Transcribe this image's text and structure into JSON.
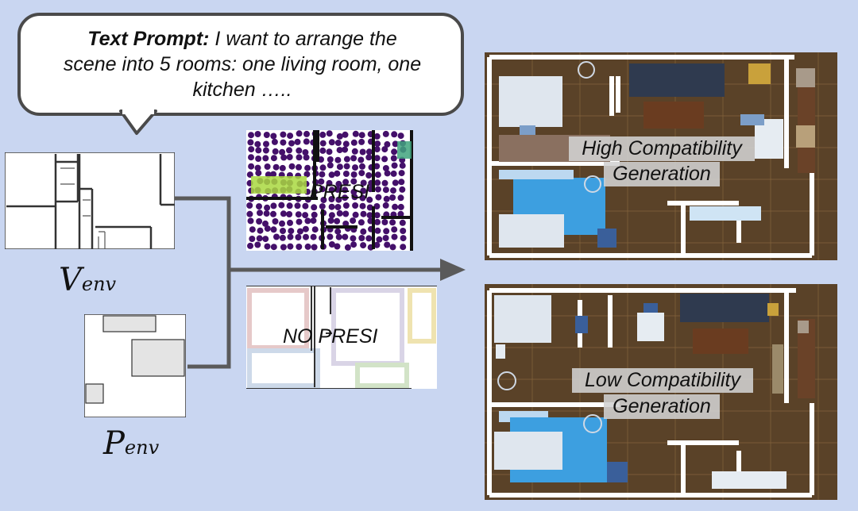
{
  "prompt": {
    "lead": "Text Prompt:",
    "line1_rest": " I want to arrange the",
    "line2": "scene into 5 rooms: one living room, one",
    "line3": "kitchen ….."
  },
  "inputs": {
    "v_env_main": "V",
    "v_env_sub": "env",
    "p_env_main": "P",
    "p_env_sub": "env"
  },
  "branches": {
    "presi_label": "PRESI",
    "no_presi_label": "NO PRESI"
  },
  "outputs": {
    "high_line1": "High Compatibility",
    "high_line2": "Generation",
    "low_line1": "Low Compatibility",
    "low_line2": "Generation"
  },
  "colors": {
    "background": "#c9d6f1",
    "connector": "#5a5a5a",
    "heatmap_dot": "#44106a",
    "water": "#3d9fe0",
    "floor": "#5a4228"
  }
}
